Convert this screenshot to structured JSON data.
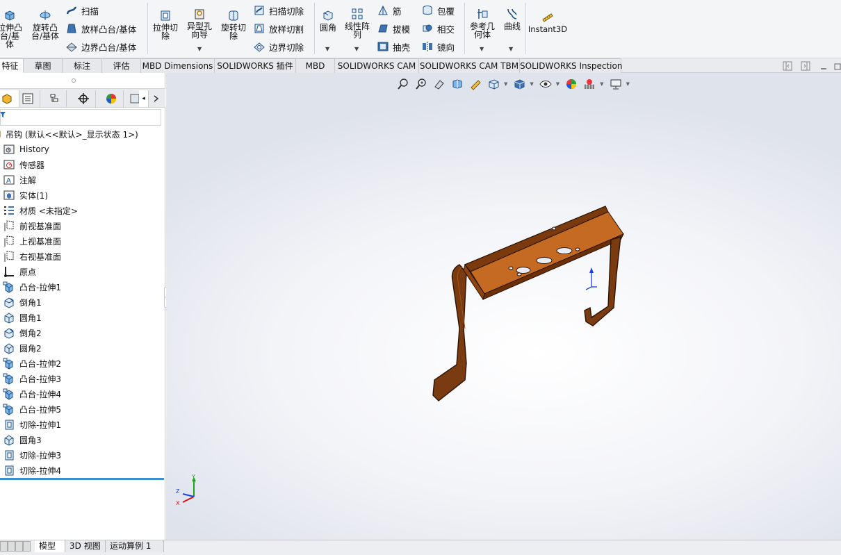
{
  "ribbon": {
    "extrude_boss": "拉伸凸台/基体",
    "revolve_boss": "旋转凸台/基体",
    "sweep": "扫描",
    "loft_boss": "放样凸台/基体",
    "boundary_boss": "边界凸台/基体",
    "extrude_cut": "拉伸切除",
    "hole_wizard": "异型孔向导",
    "revolve_cut": "旋转切除",
    "swept_cut": "扫描切除",
    "lofted_cut": "放样切割",
    "boundary_cut": "边界切除",
    "fillet": "圆角",
    "linear_pattern": "线性阵列",
    "rib": "筋",
    "draft": "拔模",
    "shell": "抽壳",
    "wrap": "包覆",
    "intersect": "相交",
    "mirror": "镜向",
    "ref_geometry": "参考几何体",
    "curves": "曲线",
    "instant3d": "Instant3D"
  },
  "tabs": [
    {
      "label": "特征"
    },
    {
      "label": "草图"
    },
    {
      "label": "标注"
    },
    {
      "label": "评估"
    },
    {
      "label": "MBD Dimensions"
    },
    {
      "label": "SOLIDWORKS 插件"
    },
    {
      "label": "MBD"
    },
    {
      "label": "SOLIDWORKS CAM"
    },
    {
      "label": "SOLIDWORKS CAM TBM"
    },
    {
      "label": "SOLIDWORKS Inspection"
    }
  ],
  "tree": {
    "root": "吊钩  (默认<<默认>_显示状态 1>)",
    "items": [
      {
        "label": "History",
        "icon": "history-icon"
      },
      {
        "label": "传感器",
        "icon": "sensor-icon"
      },
      {
        "label": "注解",
        "icon": "annotation-icon"
      },
      {
        "label": "实体(1)",
        "icon": "solid-body-icon"
      },
      {
        "label": "材质 <未指定>",
        "icon": "material-icon"
      },
      {
        "label": "前视基准面",
        "icon": "plane-icon"
      },
      {
        "label": "上视基准面",
        "icon": "plane-icon"
      },
      {
        "label": "右视基准面",
        "icon": "plane-icon"
      },
      {
        "label": "原点",
        "icon": "origin-icon"
      },
      {
        "label": "凸台-拉伸1",
        "icon": "boss-extrude-icon"
      },
      {
        "label": "倒角1",
        "icon": "chamfer-icon"
      },
      {
        "label": "圆角1",
        "icon": "fillet-icon"
      },
      {
        "label": "倒角2",
        "icon": "chamfer-icon"
      },
      {
        "label": "圆角2",
        "icon": "fillet-icon"
      },
      {
        "label": "凸台-拉伸2",
        "icon": "boss-extrude-icon"
      },
      {
        "label": "凸台-拉伸3",
        "icon": "boss-extrude-icon"
      },
      {
        "label": "凸台-拉伸4",
        "icon": "boss-extrude-icon"
      },
      {
        "label": "凸台-拉伸5",
        "icon": "boss-extrude-icon"
      },
      {
        "label": "切除-拉伸1",
        "icon": "cut-extrude-icon"
      },
      {
        "label": "圆角3",
        "icon": "fillet-icon"
      },
      {
        "label": "切除-拉伸3",
        "icon": "cut-extrude-icon"
      },
      {
        "label": "切除-拉伸4",
        "icon": "cut-extrude-icon"
      }
    ]
  },
  "bottom_tabs": [
    {
      "label": "模型"
    },
    {
      "label": "3D 视图"
    },
    {
      "label": "运动算例 1"
    }
  ],
  "triad": {
    "x": "X",
    "y": "Y",
    "z": "Z"
  },
  "colors": {
    "part": "#8a4514",
    "part_light": "#c66b1f",
    "accent": "#3a8fd4"
  }
}
